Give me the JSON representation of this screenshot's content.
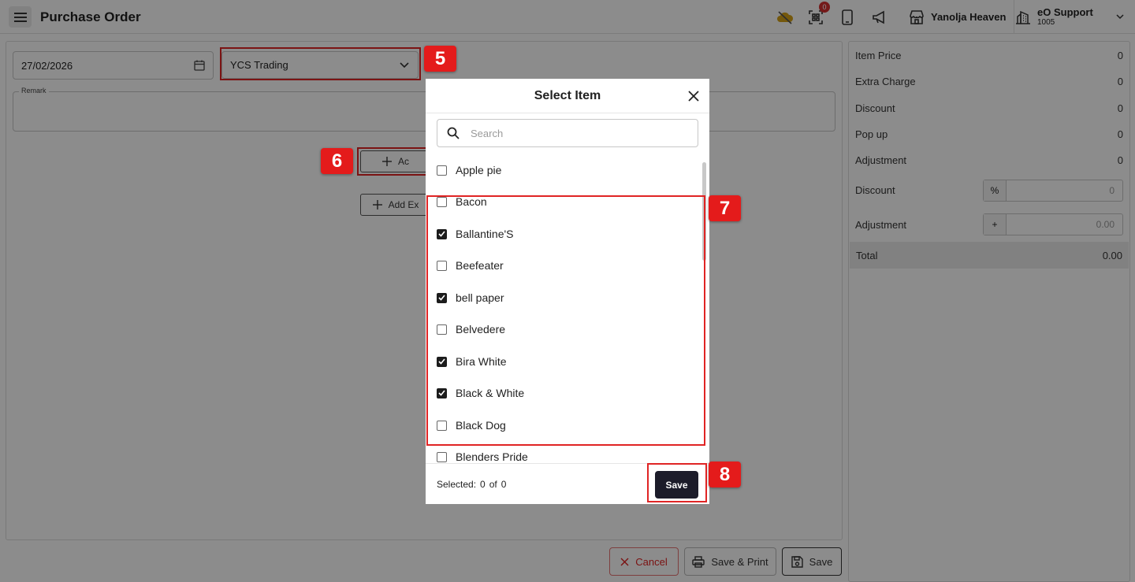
{
  "header": {
    "title": "Purchase Order",
    "notification_count": "0",
    "store_name": "Yanolja Heaven",
    "user_name": "eO Support",
    "user_id": "1005"
  },
  "form": {
    "date": "27/02/2026",
    "vendor": "YCS Trading",
    "remark_label": "Remark",
    "add_item_label": "Ac",
    "add_extra_label": "Add Ex"
  },
  "summary": {
    "rows": [
      {
        "label": "Item Price",
        "value": "0"
      },
      {
        "label": "Extra Charge",
        "value": "0"
      },
      {
        "label": "Discount",
        "value": "0"
      },
      {
        "label": "Pop up",
        "value": "0"
      },
      {
        "label": "Adjustment",
        "value": "0"
      }
    ],
    "discount_label": "Discount",
    "discount_addon": "%",
    "discount_value": "0",
    "adjustment_label": "Adjustment",
    "adjustment_addon": "+",
    "adjustment_value": "0.00",
    "total_label": "Total",
    "total_value": "0.00"
  },
  "buttons": {
    "cancel": "Cancel",
    "save_print": "Save & Print",
    "save": "Save"
  },
  "modal": {
    "title": "Select Item",
    "search_placeholder": "Search",
    "items": [
      {
        "label": "Apple pie",
        "checked": false
      },
      {
        "label": "Bacon",
        "checked": false
      },
      {
        "label": "Ballantine'S",
        "checked": true
      },
      {
        "label": "Beefeater",
        "checked": false
      },
      {
        "label": "bell paper",
        "checked": true
      },
      {
        "label": "Belvedere",
        "checked": false
      },
      {
        "label": "Bira White",
        "checked": true
      },
      {
        "label": "Black & White",
        "checked": true
      },
      {
        "label": "Black Dog",
        "checked": false
      },
      {
        "label": "Blenders Pride",
        "checked": false
      }
    ],
    "selected_label": "Selected:",
    "selected_count": "0",
    "of_label": "of",
    "total_count": "0",
    "save_label": "Save"
  },
  "callouts": [
    "5",
    "6",
    "7",
    "8"
  ],
  "colors": {
    "callout_red": "#e41b1b",
    "save_button": "#1c1c2a",
    "cancel_red": "#e02424"
  }
}
